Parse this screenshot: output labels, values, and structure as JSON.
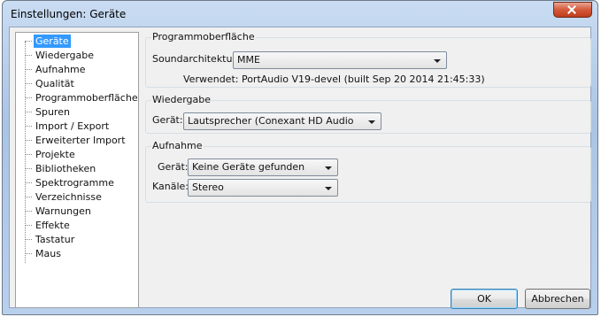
{
  "window": {
    "title": "Einstellungen: Geräte"
  },
  "sidebar": {
    "items": [
      {
        "label": "Geräte",
        "selected": true
      },
      {
        "label": "Wiedergabe"
      },
      {
        "label": "Aufnahme"
      },
      {
        "label": "Qualität"
      },
      {
        "label": "Programmoberfläche"
      },
      {
        "label": "Spuren"
      },
      {
        "label": "Import / Export"
      },
      {
        "label": "Erweiterter Import"
      },
      {
        "label": "Projekte"
      },
      {
        "label": "Bibliotheken"
      },
      {
        "label": "Spektrogramme"
      },
      {
        "label": "Verzeichnisse"
      },
      {
        "label": "Warnungen"
      },
      {
        "label": "Effekte"
      },
      {
        "label": "Tastatur"
      },
      {
        "label": "Maus"
      }
    ]
  },
  "interface": {
    "title": "Programmoberfläche",
    "host_label": "Soundarchitektur:",
    "host_value": "MME",
    "using_text": "Verwendet: PortAudio V19-devel (built Sep 20 2014 21:45:33)"
  },
  "playback": {
    "title": "Wiedergabe",
    "device_label": "Gerät:",
    "device_value": "Lautsprecher (Conexant HD Audio"
  },
  "recording": {
    "title": "Aufnahme",
    "device_label": "Gerät:",
    "device_value": "Keine Geräte gefunden",
    "channels_label": "Kanäle:",
    "channels_value": "Stereo"
  },
  "buttons": {
    "ok": "OK",
    "cancel": "Abbrechen"
  }
}
